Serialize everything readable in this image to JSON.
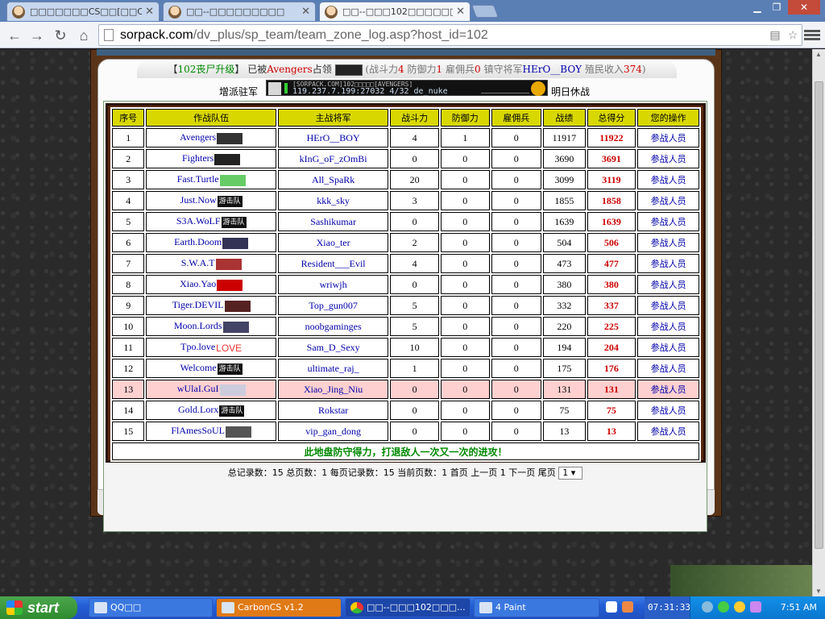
{
  "browser": {
    "tabs": [
      {
        "title": "□□□□□□□CS□□[□□C"
      },
      {
        "title": "□□--□□□□□□□□□"
      },
      {
        "title": "□□--□□□102□□□□□□"
      }
    ],
    "url_host": "sorpack.com",
    "url_path": "/dv_plus/sp_team/team_zone_log.asp?host_id=102"
  },
  "header": {
    "zone_name": "102丧尸升级",
    "taken_prefix": "已被",
    "occupier": "Avengers",
    "taken_suffix": "占领",
    "stats_lp": "(战斗力",
    "power": "4",
    "def_label": "防御力",
    "defense": "1",
    "merc_label": "雇佣兵",
    "merc": "0",
    "general_label": "镇守将军",
    "general": "HErO__BOY",
    "income_label": "殖民收入",
    "income": "374",
    "stats_rp": ")",
    "left_action": "增派驻军",
    "right_action": "明日休战"
  },
  "server": {
    "line1": "[SORPACK.COM]102□□□□□[AVENGERS]",
    "line2": "119.237.7.199:27032  4/32  de_nuke"
  },
  "table": {
    "headers": [
      "序号",
      "作战队伍",
      "主战将军",
      "战斗力",
      "防御力",
      "雇佣兵",
      "战绩",
      "总得分",
      "您的操作"
    ],
    "rows": [
      {
        "no": "1",
        "team": "Avengers",
        "logo": "",
        "general": "HErO__BOY",
        "power": "4",
        "def": "1",
        "merc": "0",
        "record": "11917",
        "score": "11922",
        "op": "参战人员"
      },
      {
        "no": "2",
        "team": "Fighters",
        "logo": "",
        "general": "kInG_oF_zOmBi",
        "power": "0",
        "def": "0",
        "merc": "0",
        "record": "3690",
        "score": "3691",
        "op": "参战人员"
      },
      {
        "no": "3",
        "team": "Fast.Turtle",
        "logo": "",
        "general": "All_SpaRk",
        "power": "20",
        "def": "0",
        "merc": "0",
        "record": "3099",
        "score": "3119",
        "op": "参战人员"
      },
      {
        "no": "4",
        "team": "Just.Now",
        "logo": "游击队",
        "general": "kkk_sky",
        "power": "3",
        "def": "0",
        "merc": "0",
        "record": "1855",
        "score": "1858",
        "op": "参战人员"
      },
      {
        "no": "5",
        "team": "S3A.WoLF",
        "logo": "游击队",
        "general": "Sashikumar",
        "power": "0",
        "def": "0",
        "merc": "0",
        "record": "1639",
        "score": "1639",
        "op": "参战人员"
      },
      {
        "no": "6",
        "team": "Earth.Doom",
        "logo": "",
        "general": "Xiao_ter",
        "power": "2",
        "def": "0",
        "merc": "0",
        "record": "504",
        "score": "506",
        "op": "参战人员"
      },
      {
        "no": "7",
        "team": "S.W.A.T",
        "logo": "",
        "general": "Resident___Evil",
        "power": "4",
        "def": "0",
        "merc": "0",
        "record": "473",
        "score": "477",
        "op": "参战人员"
      },
      {
        "no": "8",
        "team": "Xiao.Yao",
        "logo": "",
        "general": "wriwjh",
        "power": "0",
        "def": "0",
        "merc": "0",
        "record": "380",
        "score": "380",
        "op": "参战人员"
      },
      {
        "no": "9",
        "team": "Tiger.DEVIL",
        "logo": "",
        "general": "Top_gun007",
        "power": "5",
        "def": "0",
        "merc": "0",
        "record": "332",
        "score": "337",
        "op": "参战人员"
      },
      {
        "no": "10",
        "team": "Moon.Lords",
        "logo": "",
        "general": "noobgaminges",
        "power": "5",
        "def": "0",
        "merc": "0",
        "record": "220",
        "score": "225",
        "op": "参战人员"
      },
      {
        "no": "11",
        "team": "Tpo.love",
        "logo": "LOVE",
        "general": "Sam_D_Sexy",
        "power": "10",
        "def": "0",
        "merc": "0",
        "record": "194",
        "score": "204",
        "op": "参战人员"
      },
      {
        "no": "12",
        "team": "Welcome",
        "logo": "游击队",
        "general": "ultimate_raj_",
        "power": "1",
        "def": "0",
        "merc": "0",
        "record": "175",
        "score": "176",
        "op": "参战人员"
      },
      {
        "no": "13",
        "team": "wUlaI.GuI",
        "logo": "",
        "general": "Xiao_Jing_Niu",
        "power": "0",
        "def": "0",
        "merc": "0",
        "record": "131",
        "score": "131",
        "op": "参战人员"
      },
      {
        "no": "14",
        "team": "Gold.Lorx",
        "logo": "游击队",
        "general": "Rokstar",
        "power": "0",
        "def": "0",
        "merc": "0",
        "record": "75",
        "score": "75",
        "op": "参战人员"
      },
      {
        "no": "15",
        "team": "FlAmesSoUL",
        "logo": "",
        "general": "vip_gan_dong",
        "power": "0",
        "def": "0",
        "merc": "0",
        "record": "13",
        "score": "13",
        "op": "参战人员"
      }
    ],
    "footer": "此地盘防守得力，打退敌人一次又一次的进攻！"
  },
  "pager": {
    "text": "总记录数：15 总页数：1 每页记录数：15 当前页数：1 首页 上一页 1 下一页 尾页",
    "page_value": "1 ▾"
  },
  "taskbar": {
    "start": "start",
    "tasks": [
      {
        "label": "QQ□□"
      },
      {
        "label": "CarbonCS v1.2"
      },
      {
        "label": "□□--□□□102□□□..."
      },
      {
        "label": "4 Paint"
      }
    ],
    "qtime": "07:31:33",
    "clock": "7:51 AM"
  },
  "colors": {
    "accent_red": "#cc0000",
    "header_yellow": "#d8d800",
    "row_highlight": "#ffd0d0"
  }
}
